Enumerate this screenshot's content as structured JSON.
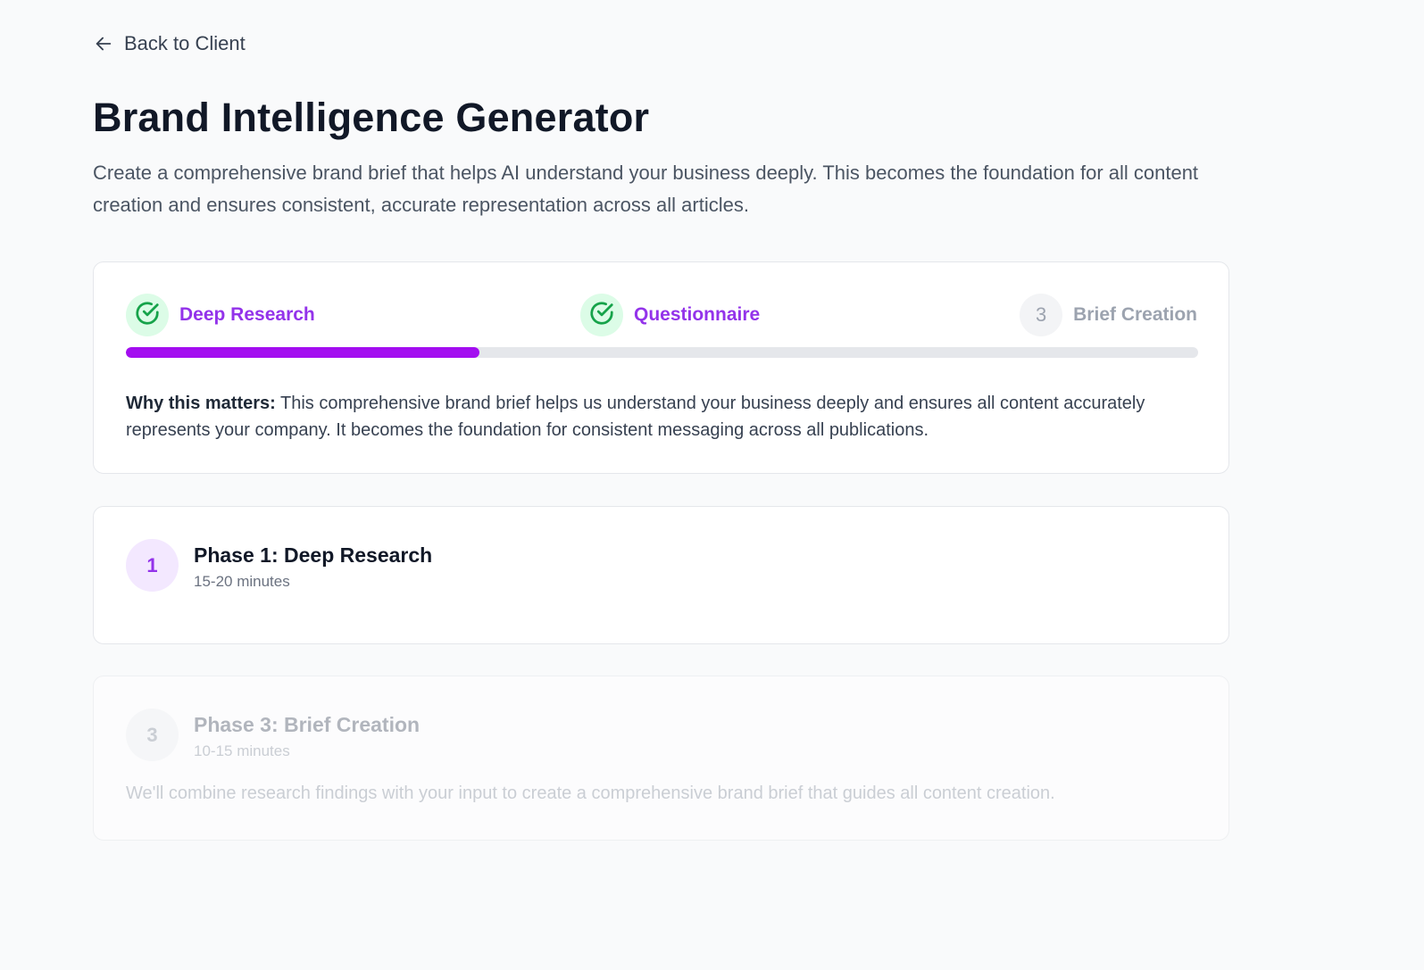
{
  "nav": {
    "back_label": "Back to Client",
    "back_icon": "arrow-left-icon"
  },
  "header": {
    "title": "Brand Intelligence Generator",
    "description": "Create a comprehensive brand brief that helps AI understand your business deeply. This becomes the foundation for all content creation and ensures consistent, accurate representation across all articles."
  },
  "progress": {
    "steps": [
      {
        "label": "Deep Research",
        "status": "completed",
        "icon": "check-circle-icon"
      },
      {
        "label": "Questionnaire",
        "status": "completed",
        "icon": "check-circle-icon"
      },
      {
        "label": "Brief Creation",
        "status": "pending",
        "number": "3"
      }
    ],
    "fill_fraction": 0.33,
    "why_label": "Why this matters:",
    "why_text": " This comprehensive brand brief helps us understand your business deeply and ensures all content accurately represents your company. It becomes the foundation for consistent messaging across all publications."
  },
  "phases": [
    {
      "number": "1",
      "title": "Phase 1: Deep Research",
      "duration": "15-20 minutes",
      "state": "active"
    },
    {
      "number": "3",
      "title": "Phase 3: Brief Creation",
      "duration": "10-15 minutes",
      "description": "We'll combine research findings with your input to create a comprehensive brand brief that guides all content creation.",
      "state": "disabled"
    }
  ],
  "colors": {
    "accent": "#9333ea",
    "progress_fill": "#a30df0",
    "success": "#16a34a",
    "success_bg": "#dcfce7",
    "background": "#f9fafb"
  }
}
